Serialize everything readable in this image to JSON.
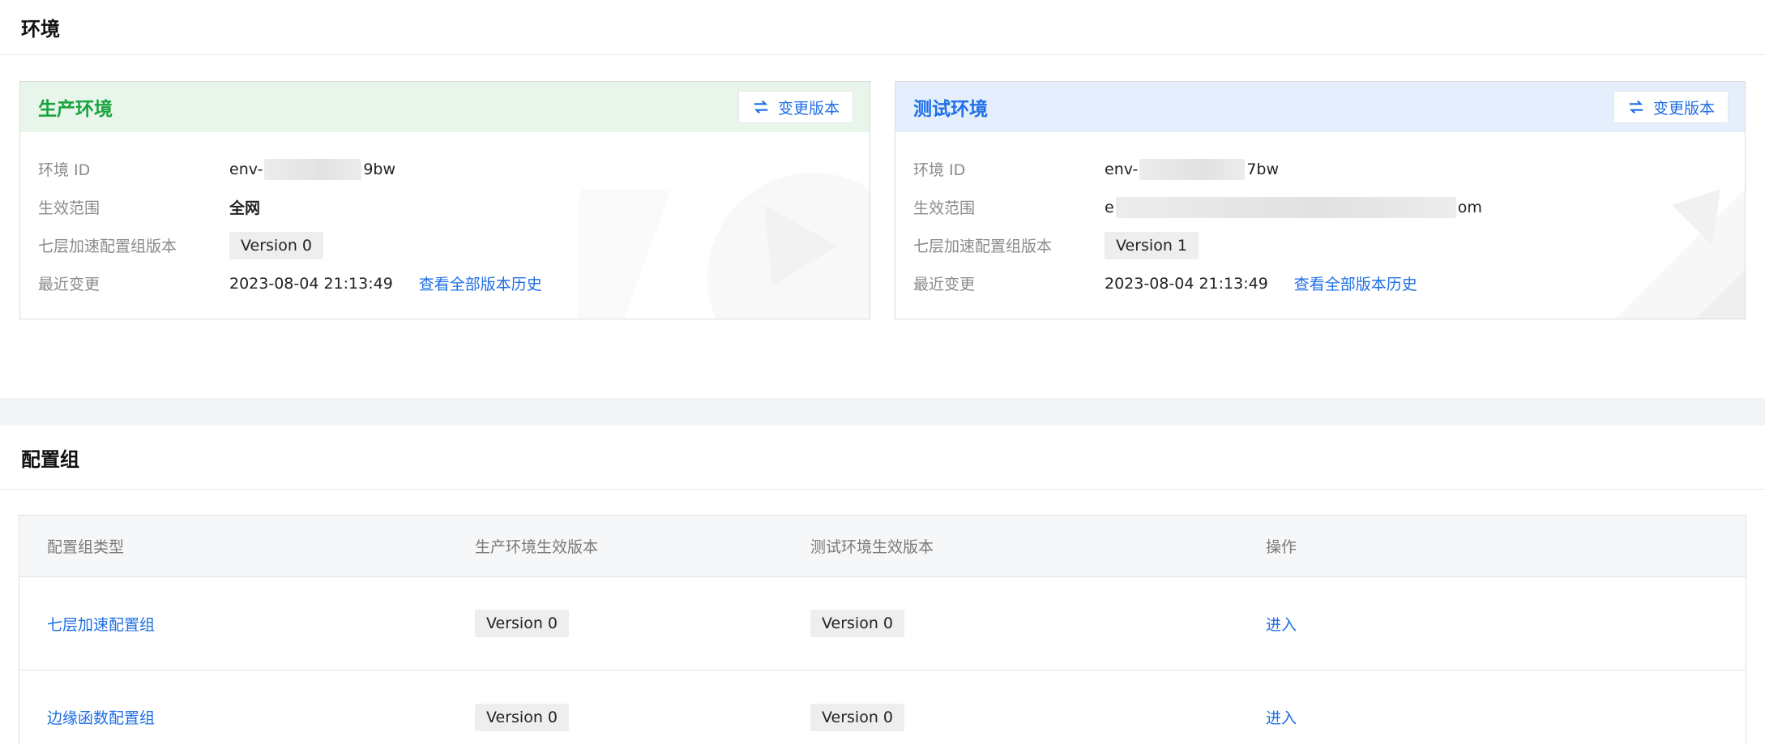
{
  "env_section": {
    "title": "环境"
  },
  "environments": [
    {
      "name": "生产环境",
      "switch_label": "变更版本",
      "fields": {
        "id_label": "环境 ID",
        "id_prefix": "env-",
        "id_suffix": "9bw",
        "scope_label": "生效范围",
        "scope_value": "全网",
        "version_label": "七层加速配置组版本",
        "version_value": "Version 0",
        "changed_label": "最近变更",
        "changed_value": "2023-08-04 21:13:49",
        "history_link": "查看全部版本历史"
      }
    },
    {
      "name": "测试环境",
      "switch_label": "变更版本",
      "fields": {
        "id_label": "环境 ID",
        "id_prefix": "env-",
        "id_suffix": "7bw",
        "scope_label": "生效范围",
        "scope_prefix": "e",
        "scope_suffix": "om",
        "version_label": "七层加速配置组版本",
        "version_value": "Version 1",
        "changed_label": "最近变更",
        "changed_value": "2023-08-04 21:13:49",
        "history_link": "查看全部版本历史"
      }
    }
  ],
  "config_section": {
    "title": "配置组"
  },
  "config_table": {
    "headers": [
      "配置组类型",
      "生产环境生效版本",
      "测试环境生效版本",
      "操作"
    ],
    "rows": [
      {
        "type": "七层加速配置组",
        "prod": "Version 0",
        "test": "Version 0",
        "action": "进入"
      },
      {
        "type": "边缘函数配置组",
        "prod": "Version 0",
        "test": "Version 0",
        "action": "进入"
      }
    ]
  },
  "colors": {
    "accent_blue": "#1e6fe6",
    "prod_green": "#1aa33f",
    "prod_head_bg": "#e7f5ea",
    "test_head_bg": "#e4eefc"
  },
  "icons": {
    "switch": "swap-arrows-icon"
  }
}
